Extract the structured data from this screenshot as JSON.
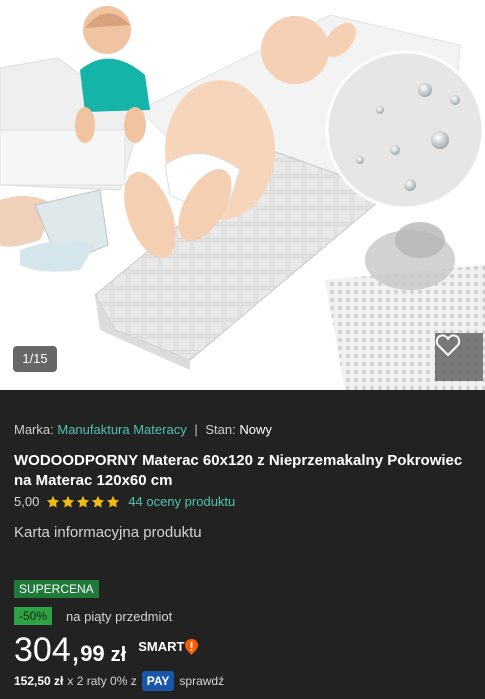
{
  "gallery": {
    "counter": "1/15"
  },
  "product": {
    "brand_label": "Marka:",
    "brand_value": "Manufaktura Materacy",
    "separator": "|",
    "condition_label": "Stan:",
    "condition_value": "Nowy",
    "title": "WODOODPORNY Materac 60x120 z Nieprzemakalny Pokrowiec na Materac 120x60 cm",
    "rating_value": "5,00",
    "rating_stars": 5,
    "reviews_link": "44 oceny produktu",
    "info_card_link": "Karta informacyjna produktu"
  },
  "offer": {
    "badge": "SUPERCENA",
    "discount": "-50%",
    "discount_note": "na piąty przedmiot",
    "price_integer": "304,",
    "price_decimal": "99",
    "currency": "zł",
    "smart_label": "SMART"
  },
  "installments": {
    "text_bold": "152,50 zł",
    "text": "x 2 raty 0% z",
    "pay_badge": "PAY",
    "check": "sprawdź"
  },
  "colors": {
    "brand_link": "#4fc3b1",
    "star": "#f2b90f",
    "supercena_bg": "#1f7a39",
    "discount_bg": "#2ea344",
    "pay_bg": "#1857a8",
    "smart_accent": "#ff5a00"
  }
}
